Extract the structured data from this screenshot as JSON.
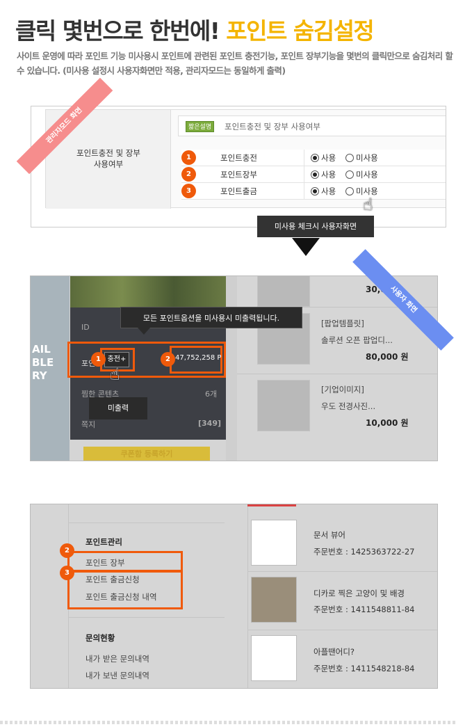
{
  "headline": {
    "main": "클릭 몇번으로 한번에!",
    "highlight": "포인트 숨김설정"
  },
  "description": "사이트 운영에 따라 포인트 기능 미사용시 포인트에 관련된 포인트 충전기능, 포인트 장부기능을 몇번의 클릭만으로 숨김처리 할 수 있습니다. (미사용 설정시 사용자화면만 적용, 관리자모드는 동일하게 출력)",
  "admin": {
    "ribbon": "관리자모드 화면",
    "label_line1": "포인트충전 및 장부",
    "label_line2": "사용여부",
    "hint_badge": "짧은설명",
    "hint_text": "포인트충전 및 장부 사용여부",
    "options": [
      {
        "num": "1",
        "label": "포인트충전",
        "use": "사용",
        "unuse": "미사용",
        "selected": "use"
      },
      {
        "num": "2",
        "label": "포인트장부",
        "use": "사용",
        "unuse": "미사용",
        "selected": "use"
      },
      {
        "num": "3",
        "label": "포인트출금",
        "use": "사용",
        "unuse": "미사용",
        "selected": "use"
      }
    ]
  },
  "arrow_tooltip": "미사용 체크시 사용자화면",
  "user": {
    "ribbon": "사용자 화면",
    "tooltip": "모든 포인트옵션을 미사용시 미출력됩니다.",
    "id_label": "ID",
    "point_label": "포인",
    "charge_btn": "충전+",
    "point_value": "47,752,258 P",
    "wish_label": "찜한 콘텐츠",
    "wish_count": "6개",
    "msg_label": "쪽지",
    "msg_count": "[349]",
    "no_output_tip": "미출력",
    "left_banner": [
      "AIL",
      "BLE",
      "RY"
    ],
    "coupon_btn": "쿠폰함 등록하기",
    "products": [
      {
        "cat": "",
        "name": "",
        "price": "30,000"
      },
      {
        "cat": "[팝업템플릿]",
        "name": "솔루션 오픈 팝업디...",
        "price": "80,000 원"
      },
      {
        "cat": "[기업이미지]",
        "name": "우도 전경사진...",
        "price": "10,000 원"
      }
    ],
    "num1": "1",
    "num2": "2"
  },
  "mypage": {
    "point_head": "포인트관리",
    "point_items": [
      "포인트 장부",
      "포인트 출금신청",
      "포인트 출금신청 내역"
    ],
    "inquiry_head": "문의현황",
    "inquiry_items": [
      "내가 받은 문의내역",
      "내가 보낸 문의내역"
    ],
    "num2": "2",
    "num3": "3",
    "orders": [
      {
        "title": "문서 뷰어",
        "order": "주문번호 : 1425363722-27"
      },
      {
        "title": "디카로 찍은 고양이 및 배경",
        "order": "주문번호 : 1411548811-84"
      },
      {
        "title": "아플땐어디?",
        "order": "주문번호 : 1411548218-84"
      }
    ]
  },
  "colors": {
    "accent": "#f4b400",
    "orange": "#f05a0b",
    "pink_ribbon": "#f68d8d",
    "blue_ribbon": "#6b8ef1"
  }
}
